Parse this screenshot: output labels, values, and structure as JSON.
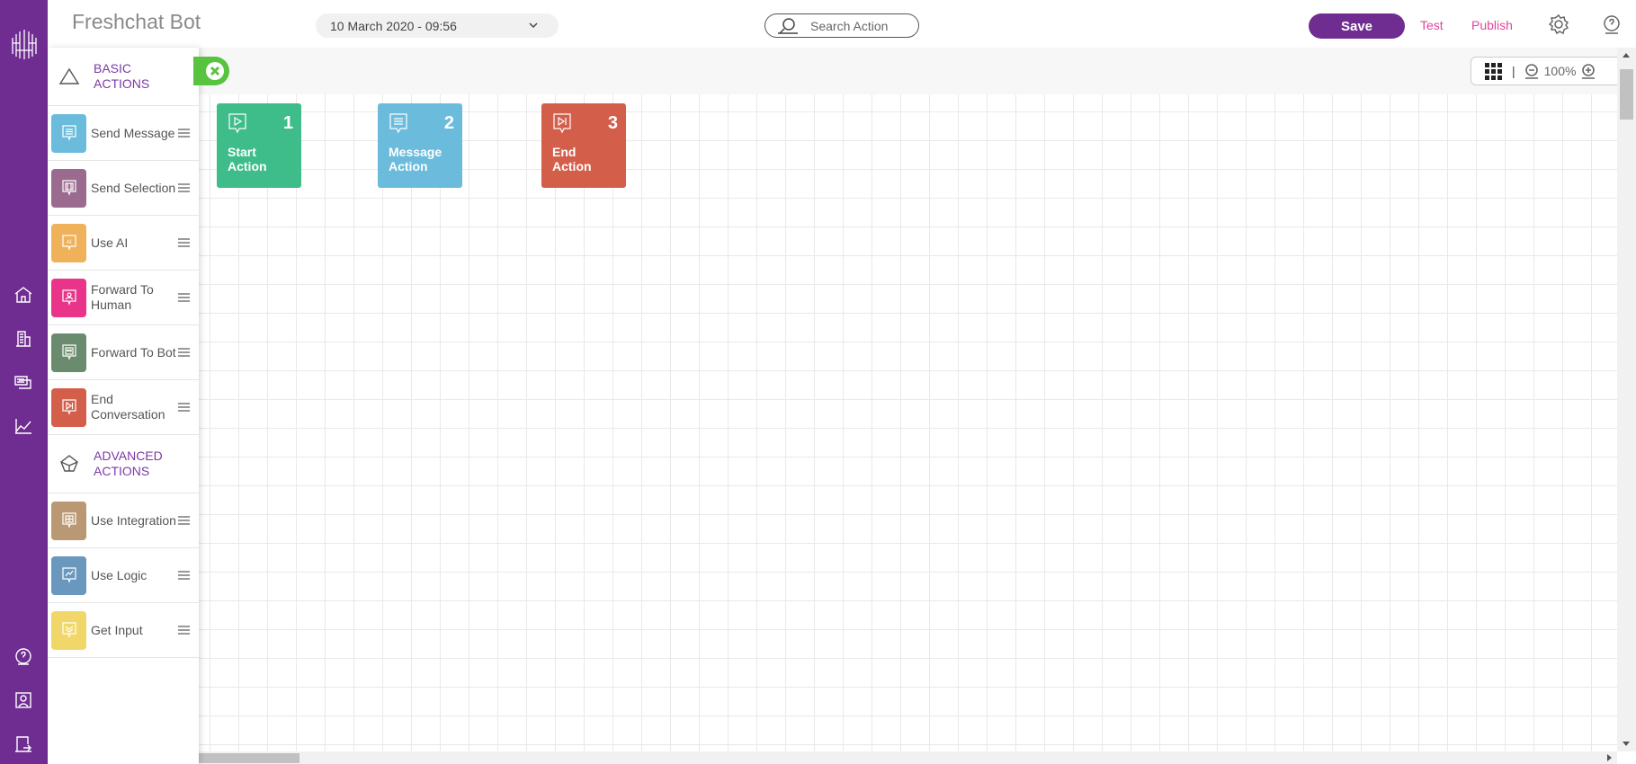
{
  "header": {
    "app_title": "Freshchat Bot",
    "version_select": "10 March 2020 - 09:56",
    "search_placeholder": "Search Action",
    "save_label": "Save",
    "test_label": "Test",
    "publish_label": "Publish"
  },
  "colors": {
    "brand": "#6f2c91",
    "link": "#e0469a",
    "close_green": "#58c33e"
  },
  "rail_icons": [
    "home-icon",
    "building-icon",
    "inbox-icon",
    "analytics-icon",
    "help-icon",
    "profile-icon",
    "logout-icon"
  ],
  "palette": {
    "basic_heading": "BASIC ACTIONS",
    "advanced_heading": "ADVANCED ACTIONS",
    "basic_items": [
      {
        "label": "Send Message",
        "color": "#6bbcdc",
        "icon": "message-icon"
      },
      {
        "label": "Send Selection",
        "color": "#9a6b8f",
        "icon": "selection-icon"
      },
      {
        "label": "Use AI",
        "color": "#efb25b",
        "icon": "ai-icon"
      },
      {
        "label": "Forward To Human",
        "color": "#e9348a",
        "icon": "human-icon"
      },
      {
        "label": "Forward To Bot",
        "color": "#6b8b6e",
        "icon": "bot-icon"
      },
      {
        "label": "End Conversation",
        "color": "#d35f4b",
        "icon": "end-icon"
      }
    ],
    "advanced_items": [
      {
        "label": "Use Integration",
        "color": "#b99873",
        "icon": "integration-icon"
      },
      {
        "label": "Use Logic",
        "color": "#6a97bd",
        "icon": "logic-icon"
      },
      {
        "label": "Get Input",
        "color": "#f1d76a",
        "icon": "input-icon"
      }
    ]
  },
  "zoom": {
    "level": "100%"
  },
  "nodes": [
    {
      "number": "1",
      "label": "Start Action",
      "color": "#3ebd8a",
      "icon": "play-icon"
    },
    {
      "number": "2",
      "label": "Message Action",
      "color": "#6bbcdc",
      "icon": "message-icon"
    },
    {
      "number": "3",
      "label": "End Action",
      "color": "#d35f4b",
      "icon": "end-icon"
    }
  ]
}
